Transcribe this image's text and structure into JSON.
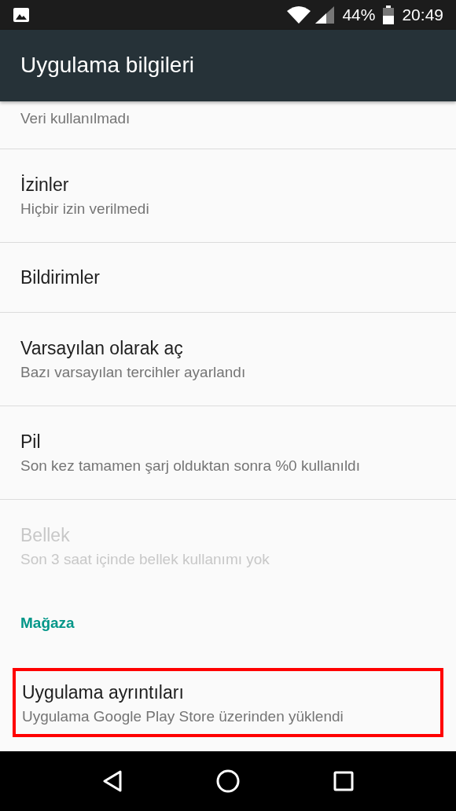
{
  "status_bar": {
    "battery": "44%",
    "time": "20:49"
  },
  "app_bar": {
    "title": "Uygulama bilgileri"
  },
  "items": [
    {
      "kind": "partial",
      "subtitle": "Veri kullanılmadı",
      "disabled": false,
      "highlighted": false
    },
    {
      "kind": "setting",
      "title": "İzinler",
      "subtitle": "Hiçbir izin verilmedi",
      "disabled": false,
      "highlighted": false
    },
    {
      "kind": "setting",
      "title": "Bildirimler",
      "disabled": false,
      "highlighted": false
    },
    {
      "kind": "setting",
      "title": "Varsayılan olarak aç",
      "subtitle": "Bazı varsayılan tercihler ayarlandı",
      "disabled": false,
      "highlighted": false
    },
    {
      "kind": "setting",
      "title": "Pil",
      "subtitle": "Son kez tamamen şarj olduktan sonra %0 kullanıldı",
      "disabled": false,
      "highlighted": false
    },
    {
      "kind": "setting",
      "title": "Bellek",
      "subtitle": "Son 3 saat içinde bellek kullanımı yok",
      "disabled": true,
      "highlighted": false
    },
    {
      "kind": "header",
      "title": "Mağaza"
    },
    {
      "kind": "setting",
      "title": "Uygulama ayrıntıları",
      "subtitle": "Uygulama Google Play Store üzerinden yüklendi",
      "disabled": false,
      "highlighted": true
    }
  ]
}
